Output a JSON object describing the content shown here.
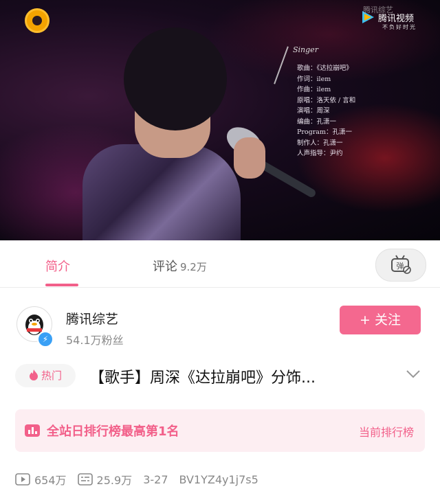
{
  "video": {
    "overlay_brand": "腾讯视频",
    "overlay_slogan": "不负好时光",
    "overlay_watermark": "腾讯综艺",
    "credits_head": "Singer",
    "credits": [
      "歌曲：《达拉崩吧》",
      "作词：ilem",
      "作曲：ilem",
      "原唱：洛天依 / 言和",
      "演唱：周深",
      "编曲：孔潇一",
      "Program：孔潇一",
      "制作人：孔潇一",
      "人声指导：尹约"
    ]
  },
  "tabs": {
    "intro": "简介",
    "comments": "评论",
    "comments_count": "9.2万",
    "danmaku": "弹"
  },
  "uploader": {
    "name": "腾讯综艺",
    "fans": "54.1万粉丝",
    "follow": "+ 关注"
  },
  "title": {
    "badge": "热门",
    "text": "【歌手】周深《达拉崩吧》分饰..."
  },
  "rank": {
    "text": "全站日排行榜最高第1名",
    "link": "当前排行榜"
  },
  "stats": {
    "plays": "654万",
    "danmaku": "25.9万",
    "date": "3-27",
    "bvid": "BV1YZ4y1j7s5"
  },
  "colors": {
    "accent": "#f2608a",
    "follow_bg": "#f4688f",
    "rank_bg": "#fdeef2",
    "verified": "#3aa0f5"
  }
}
